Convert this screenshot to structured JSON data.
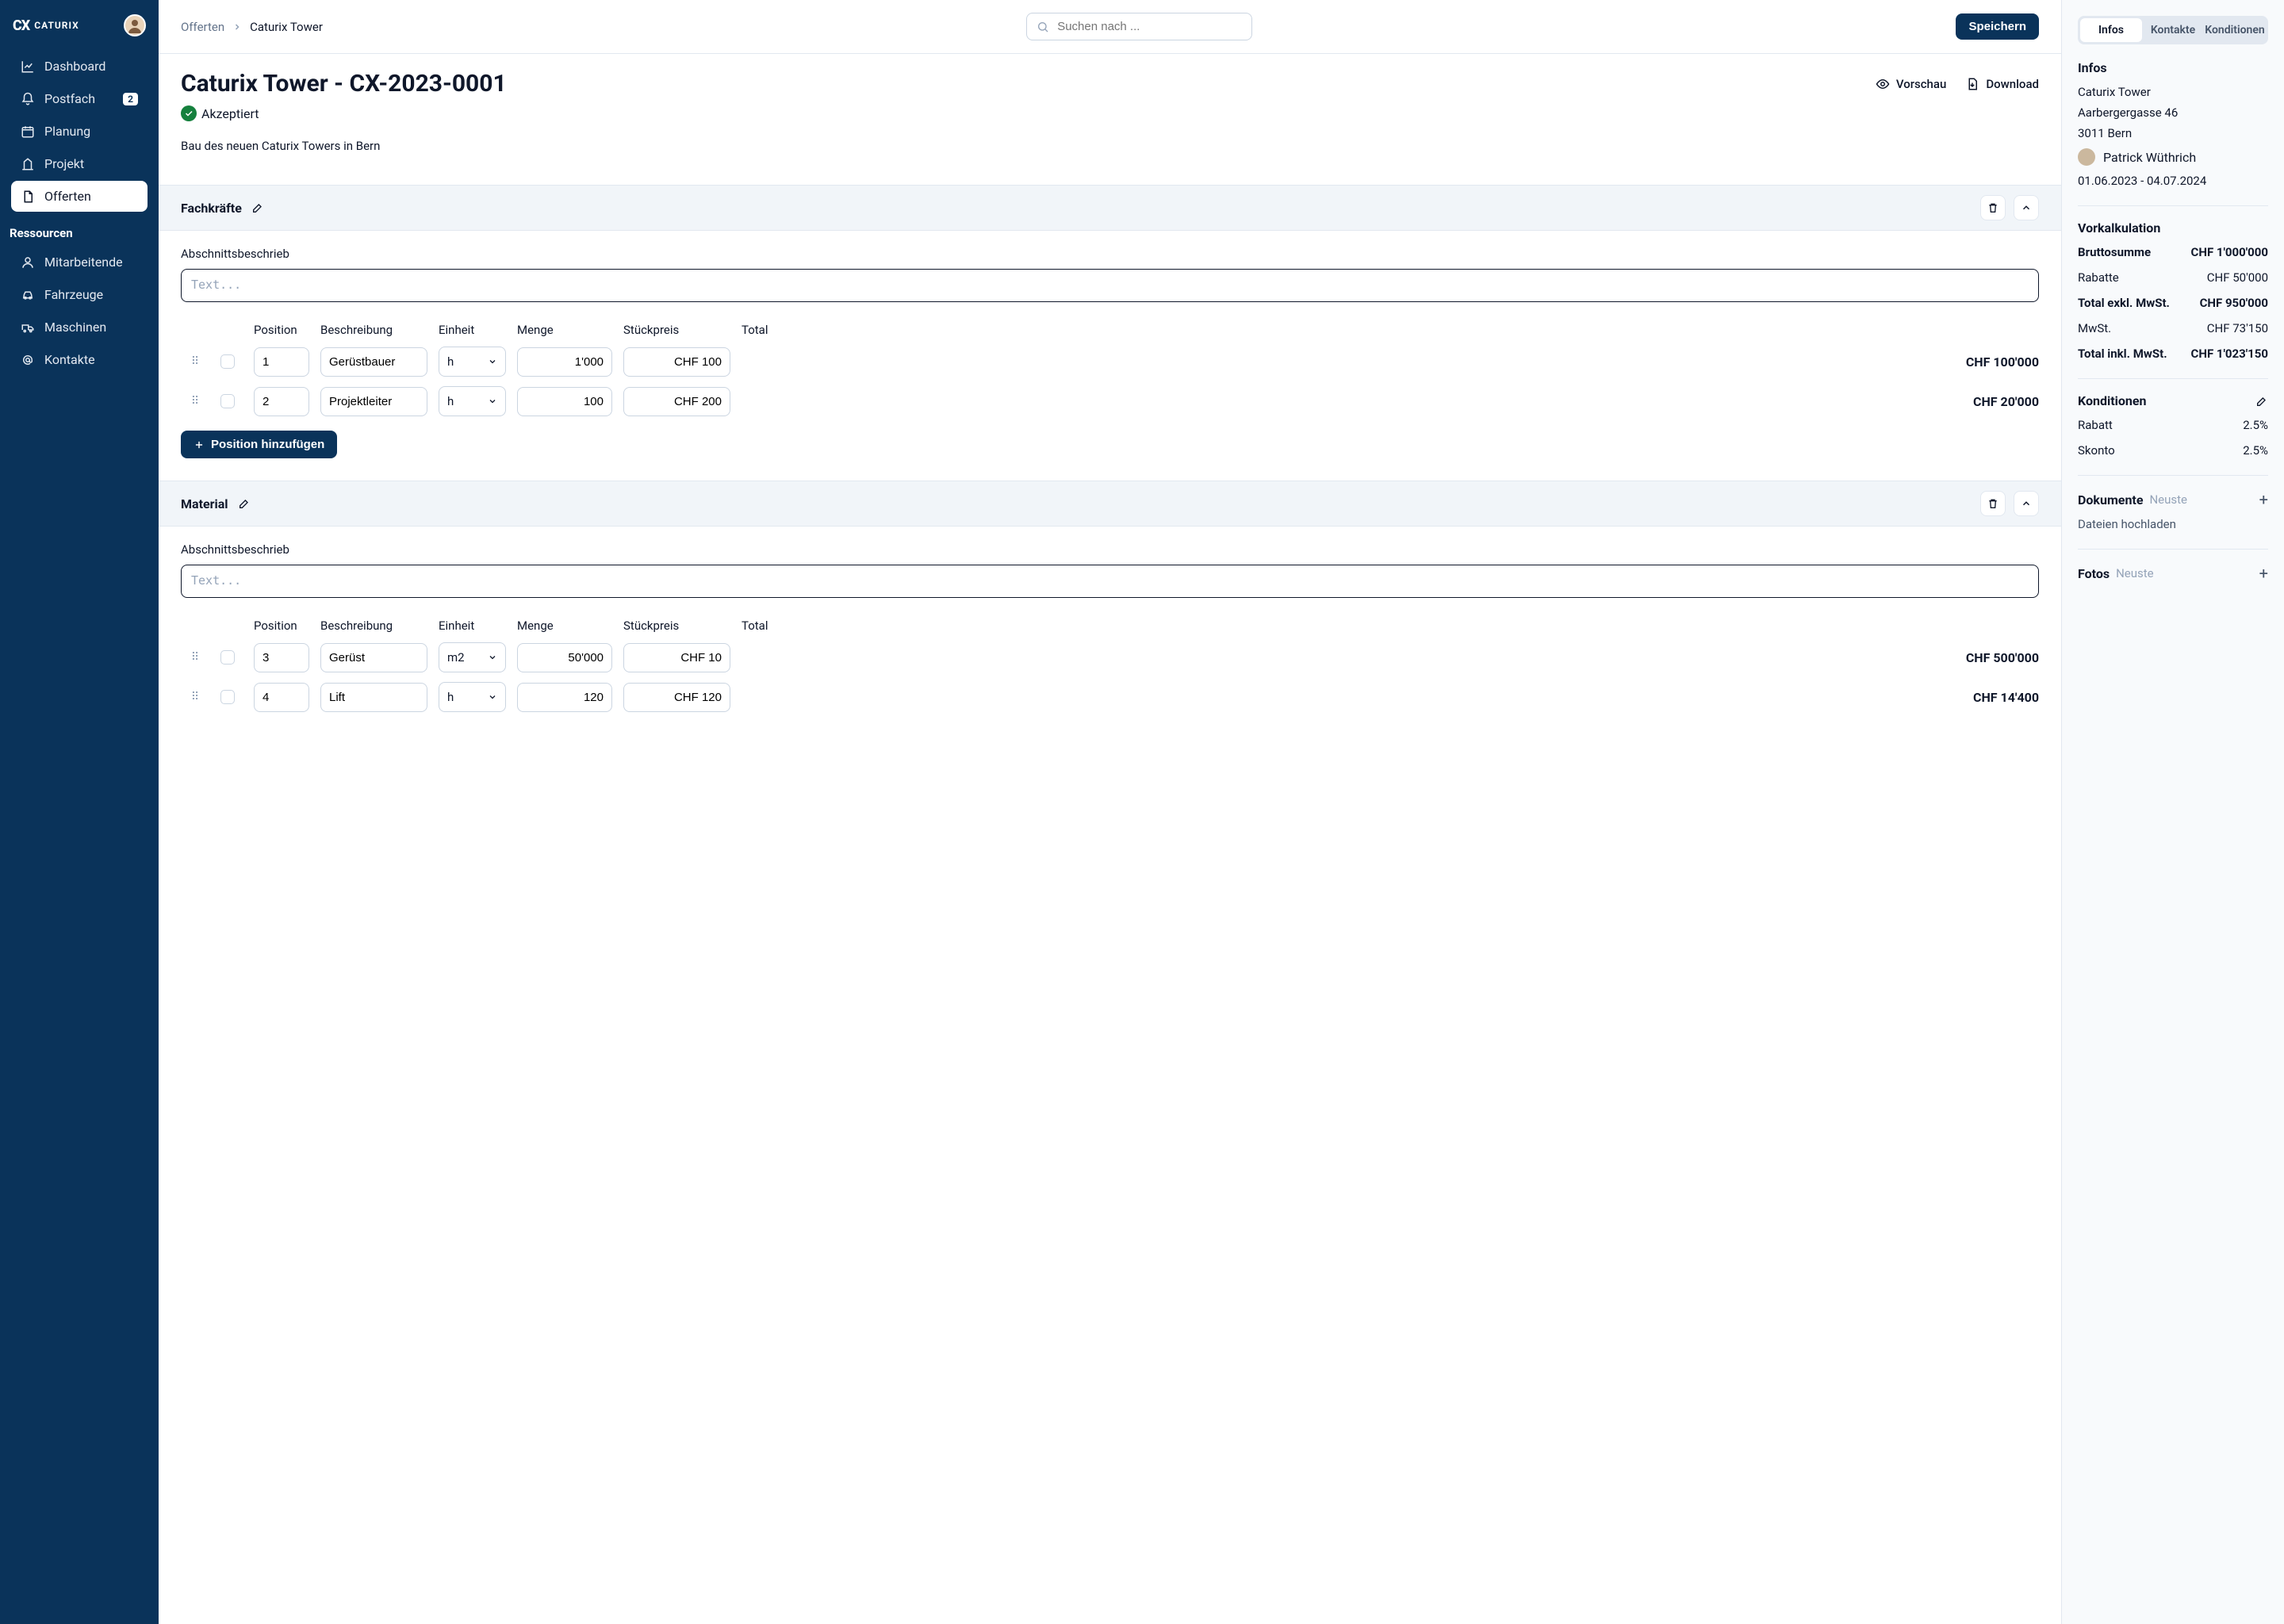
{
  "brand": "CATURIX",
  "sidebar": {
    "items": [
      {
        "label": "Dashboard"
      },
      {
        "label": "Postfach",
        "badge": "2"
      },
      {
        "label": "Planung"
      },
      {
        "label": "Projekt"
      },
      {
        "label": "Offerten"
      }
    ],
    "resources_heading": "Ressourcen",
    "resources": [
      {
        "label": "Mitarbeitende"
      },
      {
        "label": "Fahrzeuge"
      },
      {
        "label": "Maschinen"
      },
      {
        "label": "Kontakte"
      }
    ]
  },
  "topbar": {
    "breadcrumb_root": "Offerten",
    "breadcrumb_current": "Caturix Tower",
    "search_placeholder": "Suchen nach ...",
    "save_label": "Speichern"
  },
  "page": {
    "title": "Caturix Tower - CX-2023-0001",
    "preview_label": "Vorschau",
    "download_label": "Download",
    "status_label": "Akzeptiert",
    "description": "Bau des neuen Caturix Towers in Bern"
  },
  "sections": [
    {
      "title": "Fachkräfte",
      "desc_label": "Abschnittsbeschrieb",
      "desc_placeholder": "Text...",
      "headers": {
        "position": "Position",
        "beschreibung": "Beschreibung",
        "einheit": "Einheit",
        "menge": "Menge",
        "stueckpreis": "Stückpreis",
        "total": "Total"
      },
      "rows": [
        {
          "position": "1",
          "beschreibung": "Gerüstbauer",
          "einheit": "h",
          "menge": "1'000",
          "stueckpreis": "CHF 100",
          "total": "CHF 100'000"
        },
        {
          "position": "2",
          "beschreibung": "Projektleiter",
          "einheit": "h",
          "menge": "100",
          "stueckpreis": "CHF 200",
          "total": "CHF 20'000"
        }
      ],
      "add_label": "Position hinzufügen"
    },
    {
      "title": "Material",
      "desc_label": "Abschnittsbeschrieb",
      "desc_placeholder": "Text...",
      "headers": {
        "position": "Position",
        "beschreibung": "Beschreibung",
        "einheit": "Einheit",
        "menge": "Menge",
        "stueckpreis": "Stückpreis",
        "total": "Total"
      },
      "rows": [
        {
          "position": "3",
          "beschreibung": "Gerüst",
          "einheit": "m2",
          "menge": "50'000",
          "stueckpreis": "CHF 10",
          "total": "CHF 500'000"
        },
        {
          "position": "4",
          "beschreibung": "Lift",
          "einheit": "h",
          "menge": "120",
          "stueckpreis": "CHF 120",
          "total": "CHF 14'400"
        }
      ]
    }
  ],
  "right": {
    "tabs": {
      "infos": "Infos",
      "kontakte": "Kontakte",
      "konditionen": "Konditionen"
    },
    "infos_heading": "Infos",
    "project_name": "Caturix Tower",
    "address1": "Aarbergergasse 46",
    "address2": "3011 Bern",
    "contact_name": "Patrick Wüthrich",
    "date_range": "01.06.2023 - 04.07.2024",
    "vorkalkulation": {
      "heading": "Vorkalkulation",
      "rows": [
        {
          "label": "Bruttosumme",
          "value": "CHF 1'000'000",
          "bold": true
        },
        {
          "label": "Rabatte",
          "value": "CHF 50'000"
        },
        {
          "label": "Total exkl. MwSt.",
          "value": "CHF 950'000",
          "bold": true
        },
        {
          "label": "MwSt.",
          "value": "CHF 73'150"
        },
        {
          "label": "Total inkl. MwSt.",
          "value": "CHF 1'023'150",
          "bold": true
        }
      ]
    },
    "konditionen": {
      "heading": "Konditionen",
      "rows": [
        {
          "label": "Rabatt",
          "value": "2.5%"
        },
        {
          "label": "Skonto",
          "value": "2.5%"
        }
      ]
    },
    "dokumente": {
      "heading": "Dokumente",
      "sort": "Neuste",
      "upload": "Dateien hochladen"
    },
    "fotos": {
      "heading": "Fotos",
      "sort": "Neuste"
    }
  }
}
